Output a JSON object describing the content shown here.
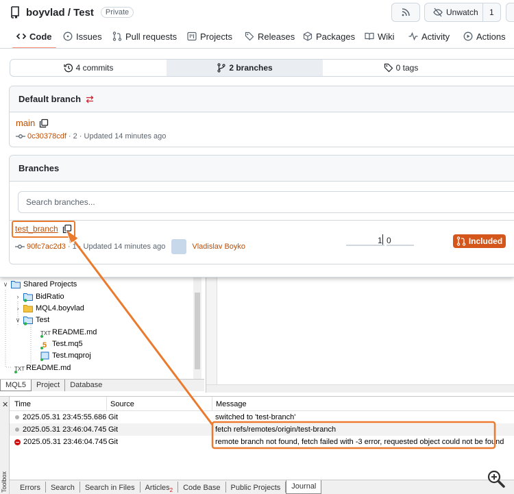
{
  "repo": {
    "title": "boyvlad / Test",
    "visibility": "Private",
    "unwatch_label": "Unwatch",
    "watch_count": "1"
  },
  "nav": {
    "code": "Code",
    "issues": "Issues",
    "pull_requests": "Pull requests",
    "projects": "Projects",
    "releases": "Releases",
    "packages": "Packages",
    "wiki": "Wiki",
    "activity": "Activity",
    "actions": "Actions"
  },
  "summary": {
    "commits": "4 commits",
    "branches": "2 branches",
    "tags": "0 tags"
  },
  "default_branch": {
    "heading": "Default branch",
    "name": "main",
    "commit": "0c30378cdf",
    "meta": "· 2 · Updated 14 minutes ago"
  },
  "branches": {
    "heading": "Branches",
    "search_placeholder": "Search branches...",
    "item": {
      "name": "test_branch",
      "commit": "90fc7ac2d3",
      "meta": "· 1 · Updated 14 minutes ago",
      "author": "Vladislav Boyko",
      "behind": "1",
      "ahead": "0",
      "status": "Included"
    }
  },
  "tree": {
    "root": "Shared Projects",
    "items": [
      "BidRatio",
      "MQL4.boyvlad",
      "Test"
    ],
    "test_children": [
      "README.md",
      "Test.mq5",
      "Test.mqproj"
    ],
    "readme": "README.md"
  },
  "nav_tabs": [
    "MQL5",
    "Project",
    "Database"
  ],
  "journal": {
    "columns": [
      "Time",
      "Source",
      "Message"
    ],
    "rows": [
      {
        "time": "2025.05.31 23:45:55.686",
        "source": "Git",
        "message": "switched to 'test-branch'"
      },
      {
        "time": "2025.05.31 23:46:04.745",
        "source": "Git",
        "message": "fetch refs/remotes/origin/test-branch"
      },
      {
        "time": "2025.05.31 23:46:04.745",
        "source": "Git",
        "message": "remote branch not found, fetch failed with -3 error, requested object could not be found"
      }
    ]
  },
  "toolbox": {
    "side_label": "Toolbox",
    "tabs": [
      "Errors",
      "Search",
      "Search in Files",
      "Articles",
      "Code Base",
      "Public Projects",
      "Journal"
    ],
    "articles_count": "2"
  },
  "colors": {
    "accent_orange": "#ea7a2e",
    "included_bg": "#d4561b",
    "link_orange": "#bc4c00",
    "error_red": "#d01010"
  }
}
